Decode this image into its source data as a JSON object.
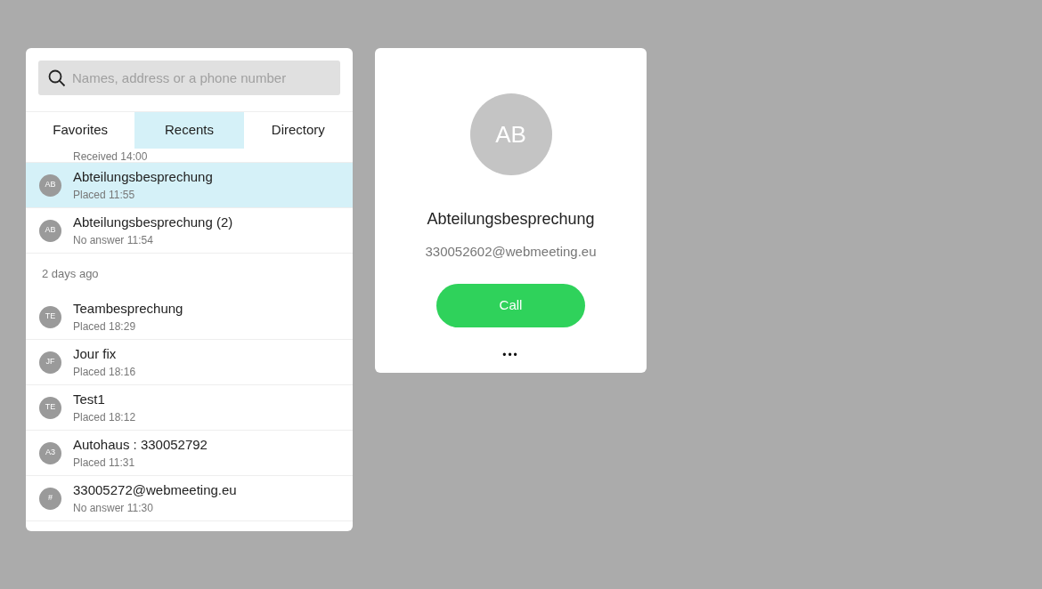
{
  "search": {
    "placeholder": "Names, address or a phone number"
  },
  "tabs": [
    {
      "label": "Favorites",
      "selected": false
    },
    {
      "label": "Recents",
      "selected": true
    },
    {
      "label": "Directory",
      "selected": false
    }
  ],
  "recents": [
    {
      "kind": "call",
      "detail": "Received 14:00",
      "selected": false
    },
    {
      "kind": "call",
      "initials": "AB",
      "name": "Abteilungsbesprechung",
      "detail": "Placed 11:55",
      "selected": true
    },
    {
      "kind": "call",
      "initials": "AB",
      "name": "Abteilungsbesprechung (2)",
      "detail": "No answer 11:54",
      "selected": false
    },
    {
      "kind": "header",
      "name": "2 days ago"
    },
    {
      "kind": "call",
      "initials": "TE",
      "name": "Teambesprechung",
      "detail": "Placed 18:29",
      "selected": false
    },
    {
      "kind": "call",
      "initials": "JF",
      "name": "Jour fix",
      "detail": "Placed 18:16",
      "selected": false
    },
    {
      "kind": "call",
      "initials": "TE",
      "name": "Test1",
      "detail": "Placed 18:12",
      "selected": false
    },
    {
      "kind": "call",
      "initials": "A3",
      "name": "Autohaus : 330052792",
      "detail": "Placed 11:31",
      "selected": false
    },
    {
      "kind": "call",
      "initials": "#",
      "name": "33005272@webmeeting.eu",
      "detail": "No answer 11:30",
      "selected": false
    }
  ],
  "contact": {
    "initials": "AB",
    "name": "Abteilungsbesprechung",
    "address": "330052602@webmeeting.eu",
    "call_button": "Call",
    "more": "•••"
  }
}
